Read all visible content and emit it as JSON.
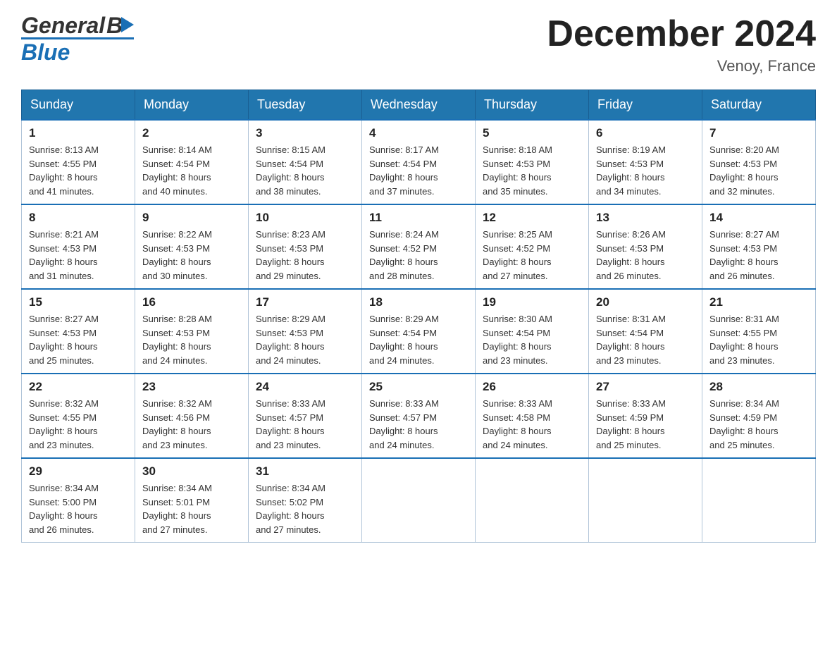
{
  "header": {
    "logo_general": "General",
    "logo_blue": "Blue",
    "title": "December 2024",
    "subtitle": "Venoy, France"
  },
  "weekdays": [
    "Sunday",
    "Monday",
    "Tuesday",
    "Wednesday",
    "Thursday",
    "Friday",
    "Saturday"
  ],
  "weeks": [
    [
      {
        "day": "1",
        "sunrise": "8:13 AM",
        "sunset": "4:55 PM",
        "daylight": "8 hours and 41 minutes."
      },
      {
        "day": "2",
        "sunrise": "8:14 AM",
        "sunset": "4:54 PM",
        "daylight": "8 hours and 40 minutes."
      },
      {
        "day": "3",
        "sunrise": "8:15 AM",
        "sunset": "4:54 PM",
        "daylight": "8 hours and 38 minutes."
      },
      {
        "day": "4",
        "sunrise": "8:17 AM",
        "sunset": "4:54 PM",
        "daylight": "8 hours and 37 minutes."
      },
      {
        "day": "5",
        "sunrise": "8:18 AM",
        "sunset": "4:53 PM",
        "daylight": "8 hours and 35 minutes."
      },
      {
        "day": "6",
        "sunrise": "8:19 AM",
        "sunset": "4:53 PM",
        "daylight": "8 hours and 34 minutes."
      },
      {
        "day": "7",
        "sunrise": "8:20 AM",
        "sunset": "4:53 PM",
        "daylight": "8 hours and 32 minutes."
      }
    ],
    [
      {
        "day": "8",
        "sunrise": "8:21 AM",
        "sunset": "4:53 PM",
        "daylight": "8 hours and 31 minutes."
      },
      {
        "day": "9",
        "sunrise": "8:22 AM",
        "sunset": "4:53 PM",
        "daylight": "8 hours and 30 minutes."
      },
      {
        "day": "10",
        "sunrise": "8:23 AM",
        "sunset": "4:53 PM",
        "daylight": "8 hours and 29 minutes."
      },
      {
        "day": "11",
        "sunrise": "8:24 AM",
        "sunset": "4:52 PM",
        "daylight": "8 hours and 28 minutes."
      },
      {
        "day": "12",
        "sunrise": "8:25 AM",
        "sunset": "4:52 PM",
        "daylight": "8 hours and 27 minutes."
      },
      {
        "day": "13",
        "sunrise": "8:26 AM",
        "sunset": "4:53 PM",
        "daylight": "8 hours and 26 minutes."
      },
      {
        "day": "14",
        "sunrise": "8:27 AM",
        "sunset": "4:53 PM",
        "daylight": "8 hours and 26 minutes."
      }
    ],
    [
      {
        "day": "15",
        "sunrise": "8:27 AM",
        "sunset": "4:53 PM",
        "daylight": "8 hours and 25 minutes."
      },
      {
        "day": "16",
        "sunrise": "8:28 AM",
        "sunset": "4:53 PM",
        "daylight": "8 hours and 24 minutes."
      },
      {
        "day": "17",
        "sunrise": "8:29 AM",
        "sunset": "4:53 PM",
        "daylight": "8 hours and 24 minutes."
      },
      {
        "day": "18",
        "sunrise": "8:29 AM",
        "sunset": "4:54 PM",
        "daylight": "8 hours and 24 minutes."
      },
      {
        "day": "19",
        "sunrise": "8:30 AM",
        "sunset": "4:54 PM",
        "daylight": "8 hours and 23 minutes."
      },
      {
        "day": "20",
        "sunrise": "8:31 AM",
        "sunset": "4:54 PM",
        "daylight": "8 hours and 23 minutes."
      },
      {
        "day": "21",
        "sunrise": "8:31 AM",
        "sunset": "4:55 PM",
        "daylight": "8 hours and 23 minutes."
      }
    ],
    [
      {
        "day": "22",
        "sunrise": "8:32 AM",
        "sunset": "4:55 PM",
        "daylight": "8 hours and 23 minutes."
      },
      {
        "day": "23",
        "sunrise": "8:32 AM",
        "sunset": "4:56 PM",
        "daylight": "8 hours and 23 minutes."
      },
      {
        "day": "24",
        "sunrise": "8:33 AM",
        "sunset": "4:57 PM",
        "daylight": "8 hours and 23 minutes."
      },
      {
        "day": "25",
        "sunrise": "8:33 AM",
        "sunset": "4:57 PM",
        "daylight": "8 hours and 24 minutes."
      },
      {
        "day": "26",
        "sunrise": "8:33 AM",
        "sunset": "4:58 PM",
        "daylight": "8 hours and 24 minutes."
      },
      {
        "day": "27",
        "sunrise": "8:33 AM",
        "sunset": "4:59 PM",
        "daylight": "8 hours and 25 minutes."
      },
      {
        "day": "28",
        "sunrise": "8:34 AM",
        "sunset": "4:59 PM",
        "daylight": "8 hours and 25 minutes."
      }
    ],
    [
      {
        "day": "29",
        "sunrise": "8:34 AM",
        "sunset": "5:00 PM",
        "daylight": "8 hours and 26 minutes."
      },
      {
        "day": "30",
        "sunrise": "8:34 AM",
        "sunset": "5:01 PM",
        "daylight": "8 hours and 27 minutes."
      },
      {
        "day": "31",
        "sunrise": "8:34 AM",
        "sunset": "5:02 PM",
        "daylight": "8 hours and 27 minutes."
      },
      null,
      null,
      null,
      null
    ]
  ],
  "labels": {
    "sunrise": "Sunrise:",
    "sunset": "Sunset:",
    "daylight": "Daylight:"
  }
}
